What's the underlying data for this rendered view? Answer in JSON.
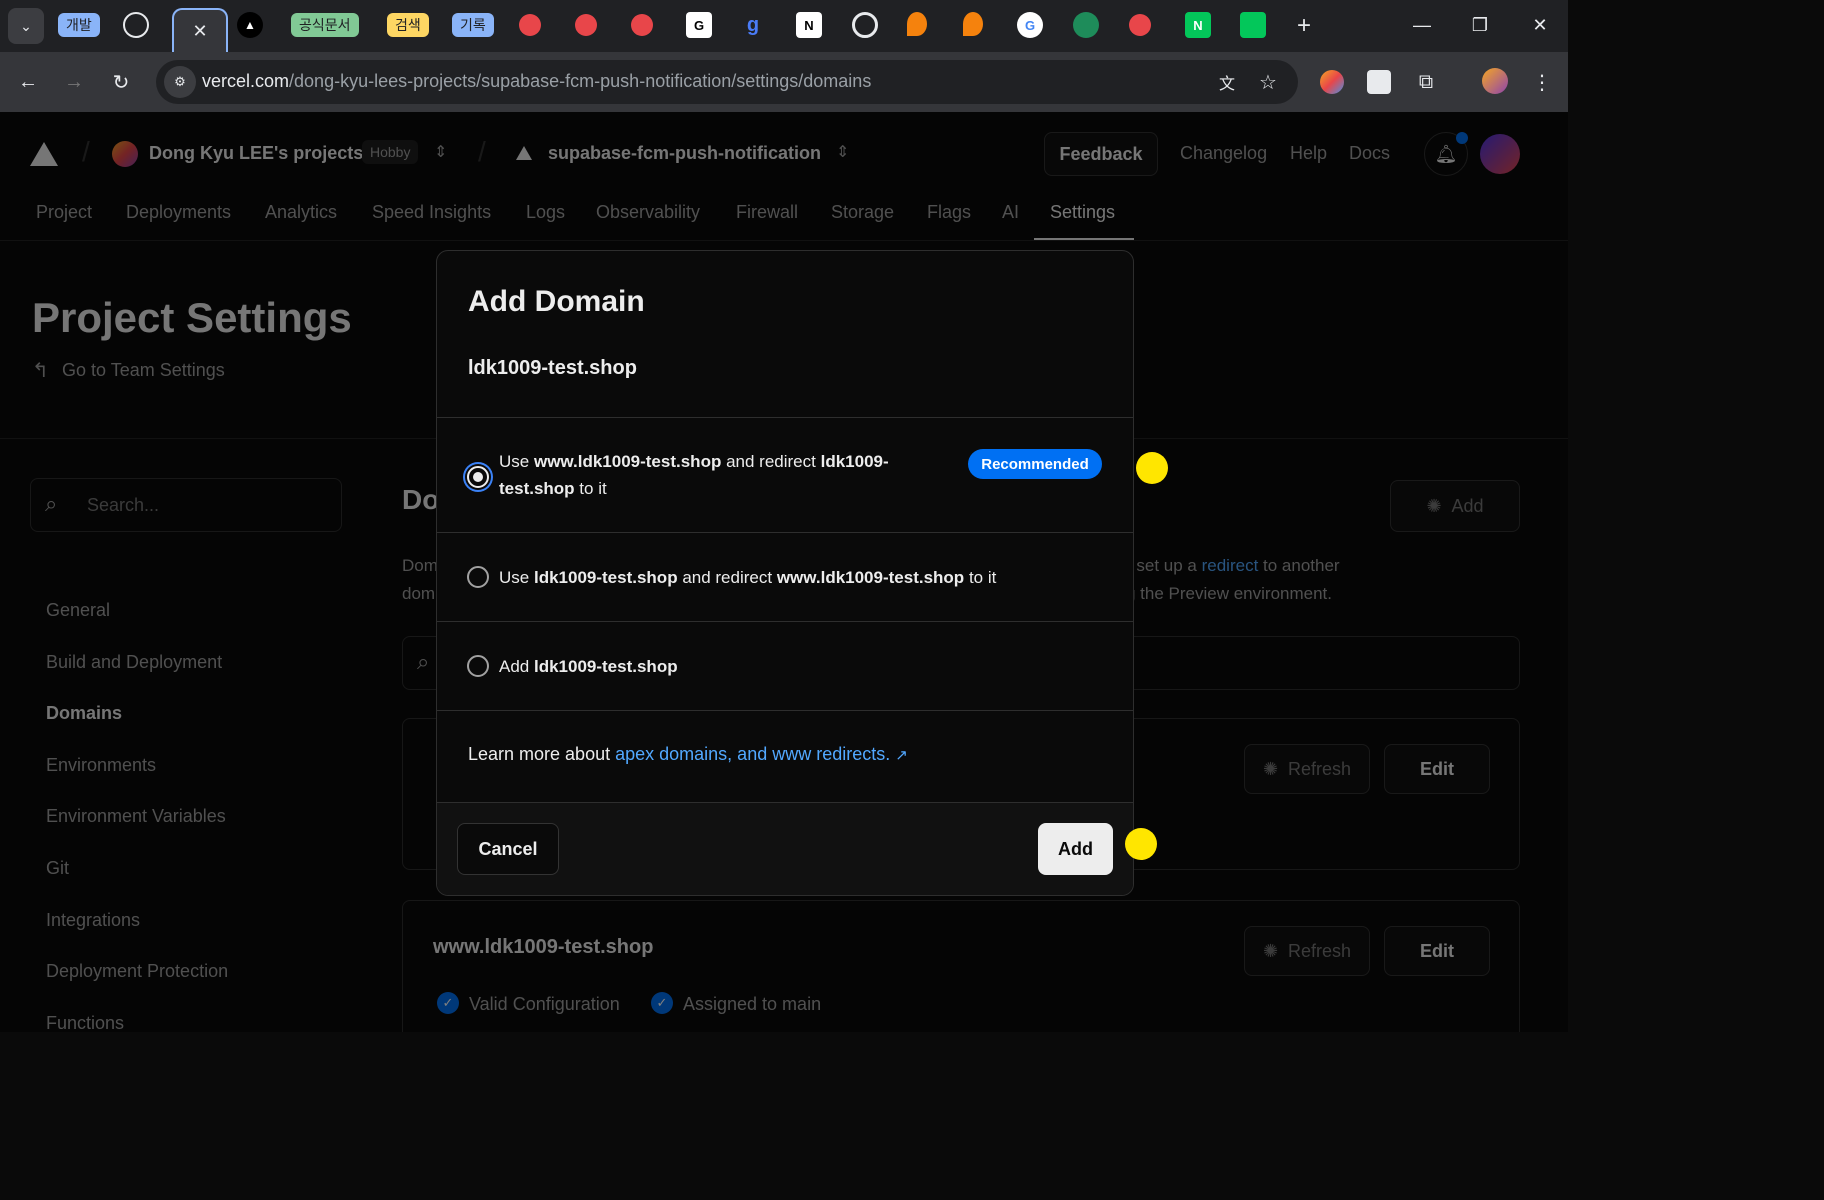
{
  "browser": {
    "tab_groups": [
      {
        "label": "개발",
        "color": "#8ab4f8"
      },
      {
        "label": "공식문서",
        "color": "#81c995"
      },
      {
        "label": "검색",
        "color": "#fdd663"
      },
      {
        "label": "기록",
        "color": "#8ab4f8"
      }
    ],
    "new_tab_symbol": "+",
    "url_host": "vercel.com",
    "url_path": "/dong-kyu-lees-projects/supabase-fcm-push-notification/settings/domains"
  },
  "header": {
    "team_name": "Dong Kyu LEE's projects",
    "plan_badge": "Hobby",
    "project_name": "supabase-fcm-push-notification",
    "feedback_label": "Feedback",
    "links": [
      "Changelog",
      "Help",
      "Docs"
    ]
  },
  "nav": {
    "tabs": [
      "Project",
      "Deployments",
      "Analytics",
      "Speed Insights",
      "Logs",
      "Observability",
      "Firewall",
      "Storage",
      "Flags",
      "AI",
      "Settings"
    ],
    "active": "Settings"
  },
  "settings": {
    "title": "Project Settings",
    "team_link": "Go to Team Settings",
    "search_placeholder": "Search...",
    "sidebar": [
      "General",
      "Build and Deployment",
      "Domains",
      "Environments",
      "Environment Variables",
      "Git",
      "Integrations",
      "Deployment Protection",
      "Functions"
    ],
    "active_sidebar": "Domains"
  },
  "main": {
    "heading_visible": "Do",
    "add_label": "Add",
    "desc_line1_left": "Dom",
    "desc_line1_right": "r set up a",
    "desc_link": "redirect",
    "desc_line1_end": "to another",
    "desc_line2_left": "dom",
    "desc_line2_right": "g the Preview environment.",
    "refresh_label": "Refresh",
    "edit_label": "Edit",
    "domain2": "www.ldk1009-test.shop",
    "status_valid": "Valid Configuration",
    "status_assigned": "Assigned to main"
  },
  "modal": {
    "title": "Add Domain",
    "domain": "ldk1009-test.shop",
    "options": [
      {
        "pre": "Use",
        "b1": "www.ldk1009-test.shop",
        "mid": "and redirect",
        "b2a": "ldk1009-",
        "b2b": "test.shop",
        "post": "to it",
        "checked": true
      },
      {
        "pre": "Use",
        "b1": "ldk1009-test.shop",
        "mid": "and redirect",
        "b2": "www.ldk1009-test.shop",
        "post": "to it",
        "checked": false
      },
      {
        "pre": "Add",
        "b1": "ldk1009-test.shop",
        "checked": false
      }
    ],
    "recommended_badge": "Recommended",
    "learn_more_prefix": "Learn more about",
    "learn_more_link": "apex domains, and www redirects.",
    "cancel_label": "Cancel",
    "add_label": "Add"
  },
  "colors": {
    "accent_blue": "#0070f3",
    "link_blue": "#52a8ff",
    "highlight_dot": "#ffe600"
  }
}
